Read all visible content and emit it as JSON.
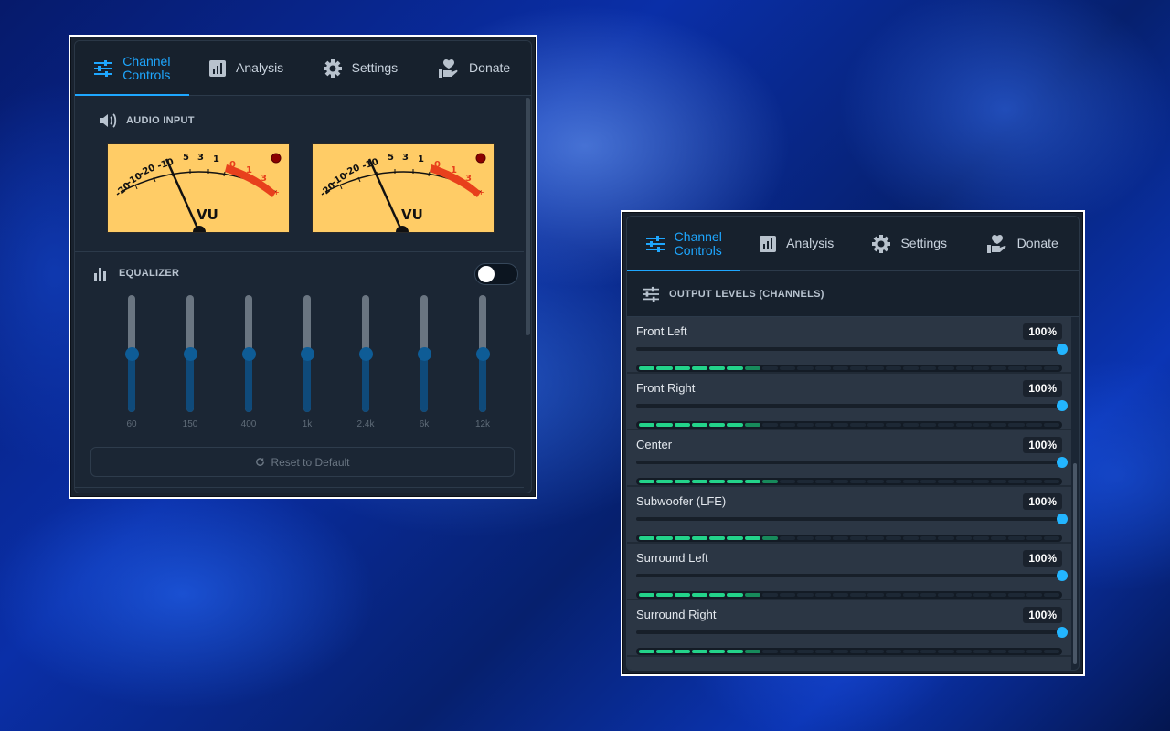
{
  "tabs": [
    {
      "label": "Channel\nControls",
      "icon": "sliders-icon",
      "active": true
    },
    {
      "label": "Analysis",
      "icon": "bar-chart-icon",
      "active": false
    },
    {
      "label": "Settings",
      "icon": "gear-icon",
      "active": false
    },
    {
      "label": "Donate",
      "icon": "donate-hand-heart-icon",
      "active": false
    }
  ],
  "left_panel": {
    "audio_input_title": "AUDIO INPUT",
    "vu_meters": [
      {
        "label": "VU",
        "scale": [
          "-20",
          "-10",
          "-20",
          "-10",
          "5",
          "3",
          "1",
          "0",
          "1",
          "3",
          "+"
        ]
      },
      {
        "label": "VU",
        "scale": [
          "-20",
          "-10",
          "-20",
          "-10",
          "5",
          "3",
          "1",
          "0",
          "1",
          "3",
          "+"
        ]
      }
    ],
    "equalizer_title": "EQUALIZER",
    "equalizer_enabled": false,
    "bands": [
      {
        "label": "60",
        "level": 0.5
      },
      {
        "label": "150",
        "level": 0.5
      },
      {
        "label": "400",
        "level": 0.5
      },
      {
        "label": "1k",
        "level": 0.5
      },
      {
        "label": "2.4k",
        "level": 0.5
      },
      {
        "label": "6k",
        "level": 0.5
      },
      {
        "label": "12k",
        "level": 0.5
      }
    ],
    "reset_label": "Reset to Default"
  },
  "right_panel": {
    "output_title": "OUTPUT LEVELS (CHANNELS)",
    "channels": [
      {
        "name": "Front Left",
        "value": "100%",
        "level": 1.0,
        "meter_on": 6
      },
      {
        "name": "Front Right",
        "value": "100%",
        "level": 1.0,
        "meter_on": 6
      },
      {
        "name": "Center",
        "value": "100%",
        "level": 1.0,
        "meter_on": 7
      },
      {
        "name": "Subwoofer (LFE)",
        "value": "100%",
        "level": 1.0,
        "meter_on": 7
      },
      {
        "name": "Surround Left",
        "value": "100%",
        "level": 1.0,
        "meter_on": 6
      },
      {
        "name": "Surround Right",
        "value": "100%",
        "level": 1.0,
        "meter_on": 6
      }
    ]
  },
  "colors": {
    "accent": "#1ea7ff",
    "meter_green": "#23d38a",
    "vu_face": "#ffcc66",
    "vu_red": "#e8401c"
  }
}
